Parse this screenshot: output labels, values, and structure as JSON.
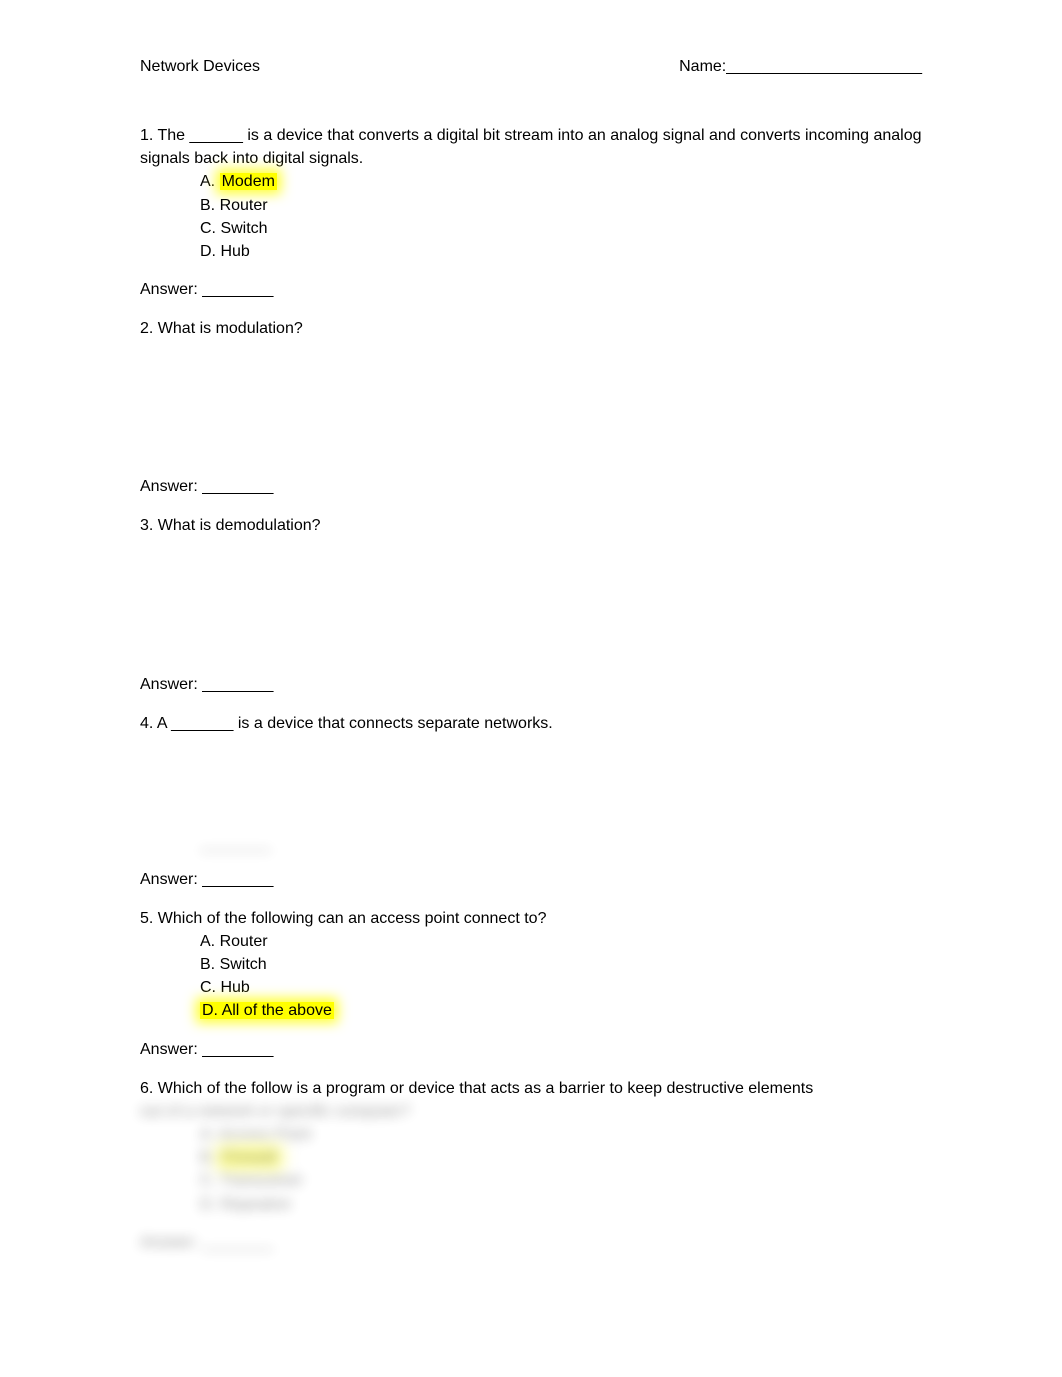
{
  "header": {
    "title": "Network Devices",
    "name_label": "Name:______________________"
  },
  "questions": {
    "q1": {
      "prompt": "1.  The ______ is a device that converts a digital bit stream into an analog signal and converts incoming analog signals back into digital signals.",
      "a_prefix": "A. ",
      "a_text": "Modem",
      "b": "B. Router",
      "c": "C. Switch",
      "d": "D. Hub",
      "answer": "Answer: ________"
    },
    "q2": {
      "prompt": "2.  What is modulation?",
      "answer": "Answer: ________"
    },
    "q3": {
      "prompt": "3.  What is demodulation?",
      "answer": "Answer: ________"
    },
    "q4": {
      "prompt": "4.  A _______ is a device that connects separate networks.",
      "hidden": "________",
      "answer": "Answer: ________"
    },
    "q5": {
      "prompt": "5.  Which of the following can an access point connect to?",
      "a": "A. Router",
      "b": "B. Switch",
      "c": "C. Hub",
      "d_prefix": "D. ",
      "d_text": "All of the above",
      "answer": "Answer: ________"
    },
    "q6": {
      "prompt": "6.  Which of the follow is a program or device that acts as a barrier to keep destructive elements",
      "hidden_line": "out of a network or specific computer?",
      "a": "A. Access Point",
      "b_prefix": "B. ",
      "b_text": "Firewall",
      "c": "C. Transceiver",
      "d": "D. Repeatrer",
      "answer": "Answer: ________"
    }
  }
}
